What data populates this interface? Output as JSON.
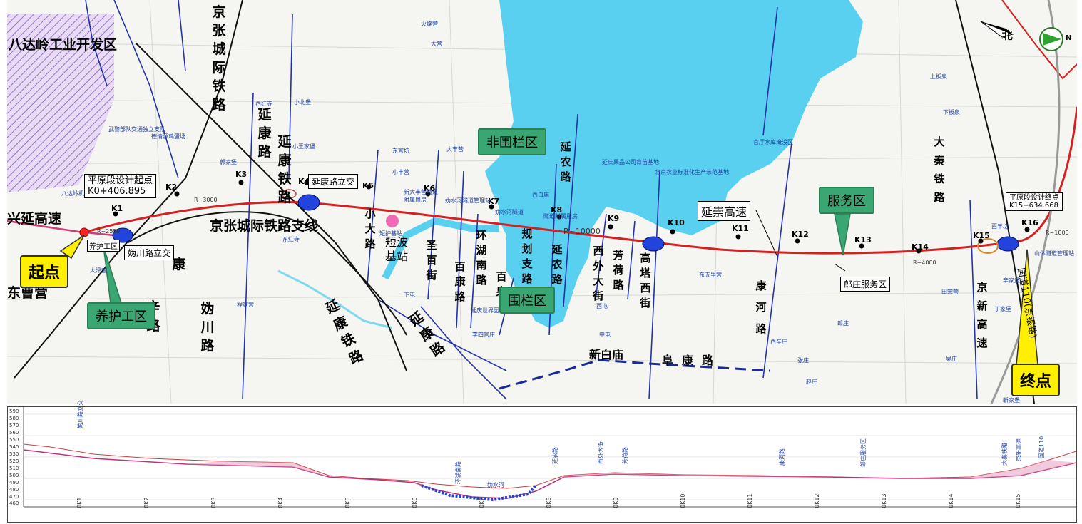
{
  "map": {
    "dev_zone": "八达岭工业开发区",
    "north": "北",
    "compass_n": "N",
    "start_callout": "起点",
    "end_callout": "终点",
    "start_box": "平原段设计起点\nK0+406.895",
    "end_box": "平原段设计终点\nK15+634.668",
    "maintenance_callout": "养护工区",
    "maintenance_box": "养护工区",
    "service_callout": "服务区",
    "service_box": "郎庄服务区",
    "nonfence_callout": "非围栏区",
    "fence_callout": "围栏区",
    "shortwave": "短波基站",
    "interchanges": [
      "延康路立交",
      "妫川路立交"
    ],
    "roads": {
      "xingyan": "兴延高速",
      "jingzhang_v": "京张城际铁路",
      "yankang_rail": "延康铁路",
      "yankang_road_v": "延康路",
      "jingzhang_h": "京张城际铁路支线",
      "yankang_rail_diag": "延康铁路",
      "yankang_road_diag": "延康路",
      "xiaoda": "小大路",
      "shengbai": "圣百街",
      "baikang": "百康路",
      "huanhu": "环湖南路",
      "baichuan": "百泉",
      "guihua": "规划支路",
      "yannong_a": "延农路",
      "yannong_b": "延农路",
      "xiwai": "西外大街",
      "fanghe": "芳荷路",
      "gaota": "高塔西街",
      "fukang": "阜康路",
      "xinbaimiao": "新白庙",
      "kanghe": "康河路",
      "yanchong": "延崇高速",
      "daqin": "大秦铁路",
      "jingxin": "京新高速",
      "guodao": "国道110(京银路)",
      "xin_road": "辛路",
      "guichuan": "妫川路",
      "kang": "康",
      "dongcaoying": "东曹营"
    },
    "places": [
      "火烧营",
      "大营",
      "小北堡",
      "西红寺",
      "小王家堡",
      "郭家堡",
      "武警部队交通独立支队",
      "德清源鸡蛋场",
      "东官坊",
      "小丰营",
      "大丰营",
      "新大丰营隧道附属用房",
      "妫水河隧道管理站",
      "西白庙",
      "隧道附属用房",
      "延庆果品公司育苗基地",
      "北京农业标准化生产示范基地",
      "官厅水库淹没区",
      "上板泉",
      "下板泉",
      "东五里营",
      "西辛庄",
      "郎庄",
      "张庄",
      "赵庄",
      "西屯",
      "中屯",
      "李四官庄",
      "延庆世界园",
      "下屯",
      "程家营",
      "大泽营",
      "八达岭机场",
      "田宋营",
      "吴庄",
      "丁家堡",
      "靳家堡",
      "西羊坊",
      "辛家堡",
      "山体隧道管理站",
      "东红寺",
      "妫水河隧道",
      "短护基站"
    ],
    "km_markers": [
      "K1",
      "K2",
      "K3",
      "K4",
      "K5",
      "K6",
      "K7",
      "K8",
      "K9",
      "K10",
      "K11",
      "K12",
      "K13",
      "K14",
      "K15",
      "K16"
    ],
    "radius_labels": [
      "R~2550",
      "R~3000",
      "R~10000",
      "R~4000",
      "R~1000"
    ],
    "colors": {
      "water": "#5ad0f0",
      "route": "#d42020",
      "road": "#2233aa",
      "green": "#3aa672",
      "yellow": "#fff000"
    }
  },
  "profile": {
    "y_ticks": [
      "590",
      "580",
      "570",
      "560",
      "550",
      "540",
      "530",
      "520",
      "510",
      "500",
      "490",
      "480",
      "470",
      "460",
      "450"
    ],
    "x_ticks": [
      "0K1",
      "0K2",
      "0K3",
      "0K4",
      "0K5",
      "0K6",
      "0K7",
      "0K8",
      "0K9",
      "0K10",
      "0K11",
      "0K12",
      "0K13",
      "0K14",
      "0K15"
    ],
    "annotations": [
      "妫川路立交",
      "延农路",
      "环湖南路",
      "妫水河",
      "芳荷路",
      "西外大街",
      "康河路",
      "郎庄服务区",
      "国道110",
      "京新高速",
      "大秦铁路"
    ]
  }
}
